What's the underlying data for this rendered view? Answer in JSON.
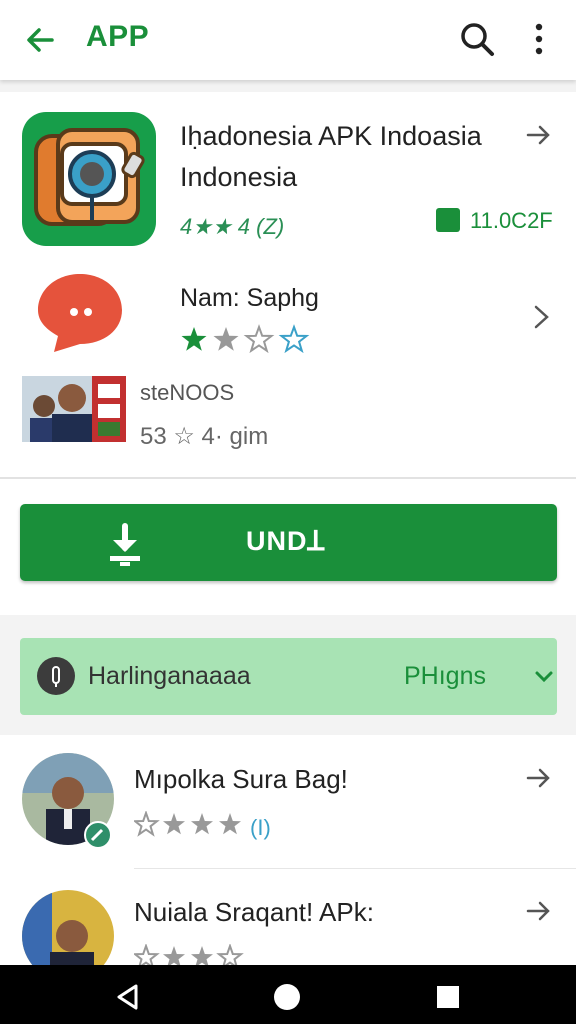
{
  "appbar": {
    "title": "APP",
    "icons": [
      "back-arrow-icon",
      "search-icon",
      "more-vert-icon"
    ]
  },
  "apps": [
    {
      "title_line1": "Iḥadonesia APK Indoasia",
      "title_line2": "Indonesia",
      "rating_text": "4★★ 4 (Z)",
      "size": "11.0C2F"
    },
    {
      "title": "Nam: Saphg",
      "rating": 2
    },
    {
      "title": "steNOOS",
      "meta": "53 ☆ 4· gim"
    }
  ],
  "install": {
    "label": "UNDꓕ"
  },
  "filter": {
    "left": "Harlinganaaaa",
    "right": "PHıgns"
  },
  "list": [
    {
      "title": "Mıpolka Sura Bag!",
      "suffix": "(I)"
    },
    {
      "title": "Nuiala Sraqant! APk:"
    }
  ],
  "colors": {
    "accent": "#1a8f3a",
    "filter_bg": "#a8e3b4"
  }
}
